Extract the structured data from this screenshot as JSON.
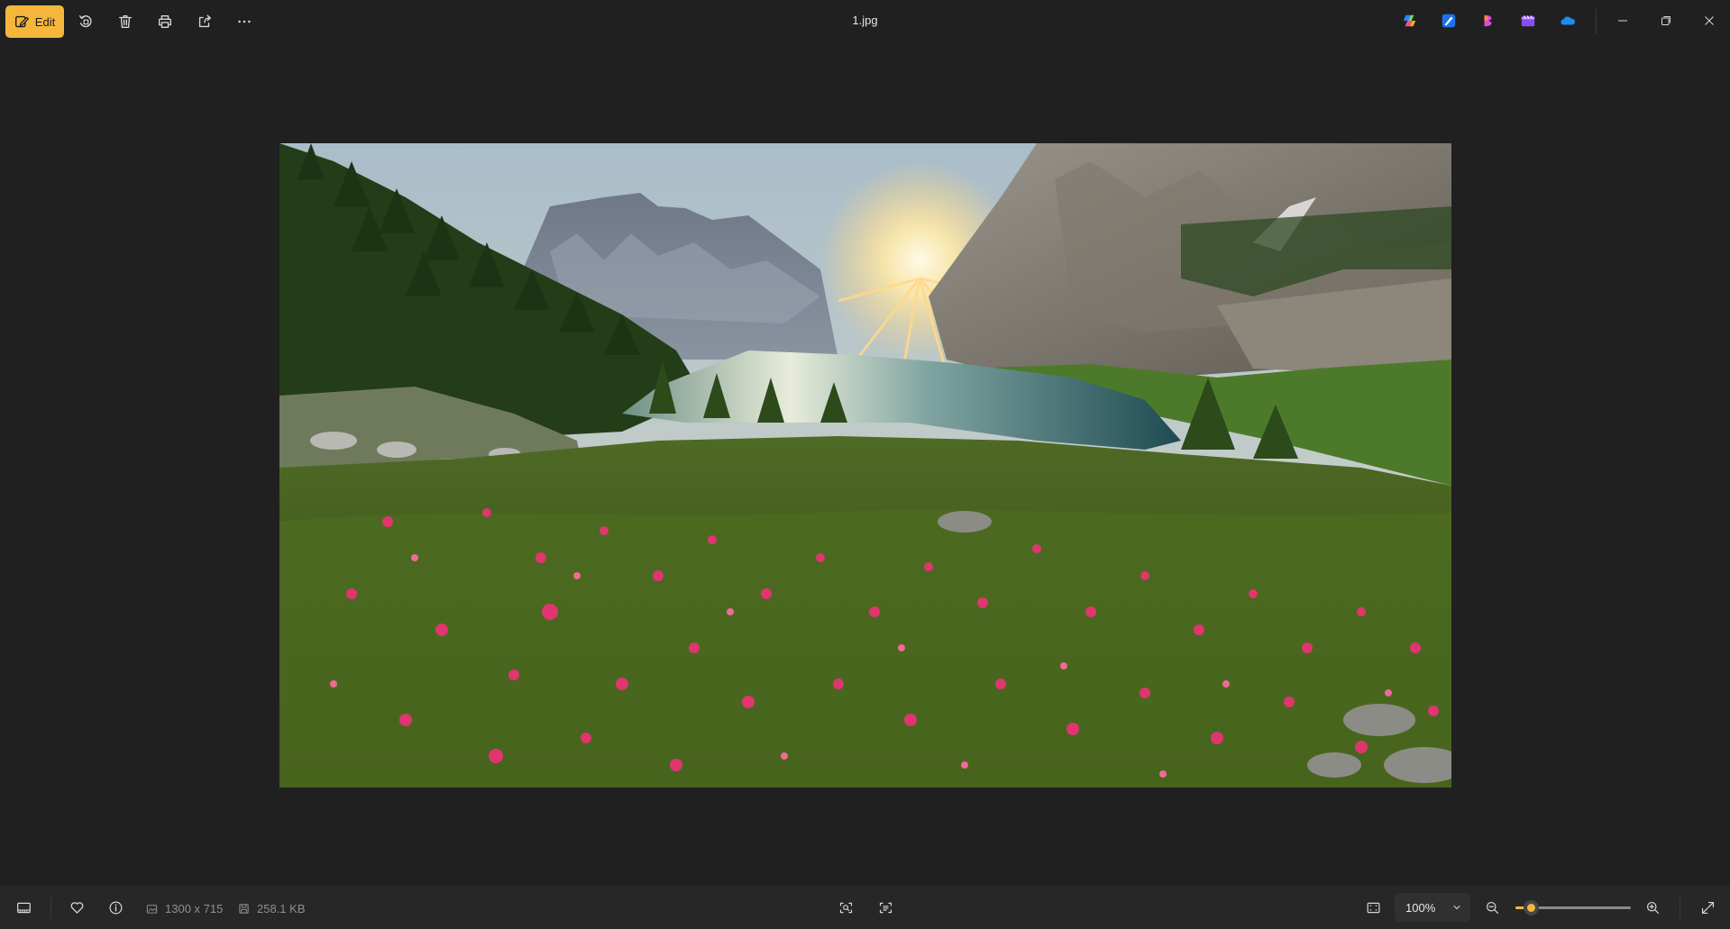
{
  "titlebar": {
    "edit_label": "Edit",
    "file_name": "1.jpg",
    "toolbar_icons": [
      "rotate-icon",
      "delete-icon",
      "print-icon",
      "share-icon",
      "more-icon"
    ],
    "app_icons": [
      "copilot-icon",
      "designer-icon",
      "clipchamp-icon",
      "video-editor-icon",
      "onedrive-icon"
    ],
    "window_controls": [
      "minimize-icon",
      "restore-icon",
      "close-icon"
    ]
  },
  "image": {
    "description": "Mountain lake landscape at sunrise with pink alpine rose flowers in the foreground"
  },
  "statusbar": {
    "dimensions": "1300 x 715",
    "file_size": "258.1 KB",
    "zoom_label": "100%",
    "zoom_level_fraction": 0.14
  },
  "colors": {
    "accent": "#f4b73c",
    "background": "#202020",
    "statusbar": "#272727"
  }
}
